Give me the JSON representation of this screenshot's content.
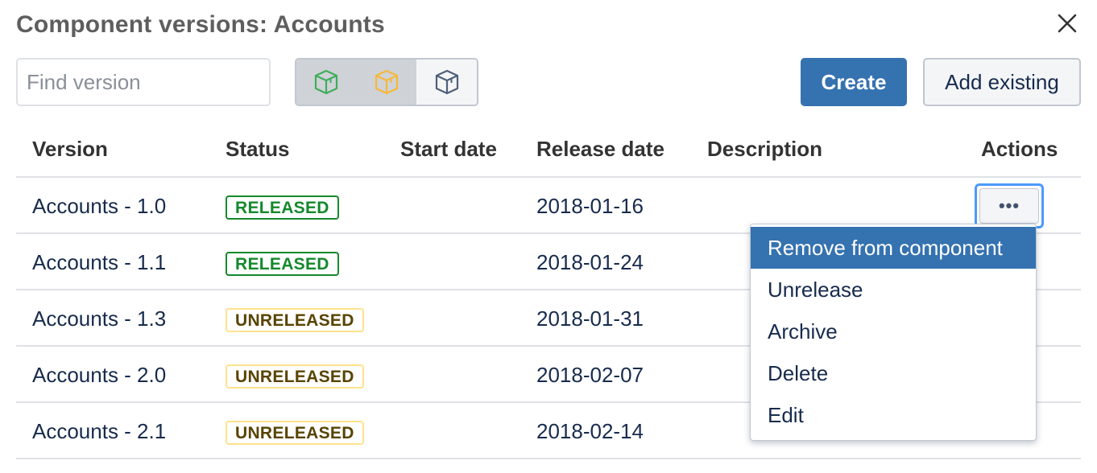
{
  "dialog": {
    "title": "Component versions: Accounts",
    "close_icon": "close-icon"
  },
  "search": {
    "placeholder": "Find version",
    "value": ""
  },
  "filters": [
    {
      "icon": "released-package-icon",
      "color": "#3fae5a",
      "state": "active"
    },
    {
      "icon": "unreleased-package-icon",
      "color": "#f6b83a",
      "state": "active"
    },
    {
      "icon": "archived-package-icon",
      "color": "#505f79",
      "state": "inactive"
    }
  ],
  "buttons": {
    "create": "Create",
    "add_existing": "Add existing"
  },
  "table": {
    "headers": {
      "version": "Version",
      "status": "Status",
      "start_date": "Start date",
      "release_date": "Release date",
      "description": "Description",
      "actions": "Actions"
    },
    "rows": [
      {
        "version": "Accounts - 1.0",
        "status": "RELEASED",
        "start_date": "",
        "release_date": "2018-01-16",
        "description": ""
      },
      {
        "version": "Accounts - 1.1",
        "status": "RELEASED",
        "start_date": "",
        "release_date": "2018-01-24",
        "description": ""
      },
      {
        "version": "Accounts - 1.3",
        "status": "UNRELEASED",
        "start_date": "",
        "release_date": "2018-01-31",
        "description": ""
      },
      {
        "version": "Accounts - 2.0",
        "status": "UNRELEASED",
        "start_date": "",
        "release_date": "2018-02-07",
        "description": ""
      },
      {
        "version": "Accounts - 2.1",
        "status": "UNRELEASED",
        "start_date": "",
        "release_date": "2018-02-14",
        "description": ""
      }
    ],
    "actions_icon": "more-icon",
    "actions_glyph": "•••"
  },
  "actions_menu": {
    "items": [
      "Remove from component",
      "Unrelease",
      "Archive",
      "Delete",
      "Edit"
    ],
    "highlighted_index": 0
  },
  "colors": {
    "primary": "#3572b0",
    "released": "#14892c",
    "unreleased_border": "#ffe28c",
    "unreleased_text": "#594300",
    "focus_ring": "#4c9aff"
  }
}
